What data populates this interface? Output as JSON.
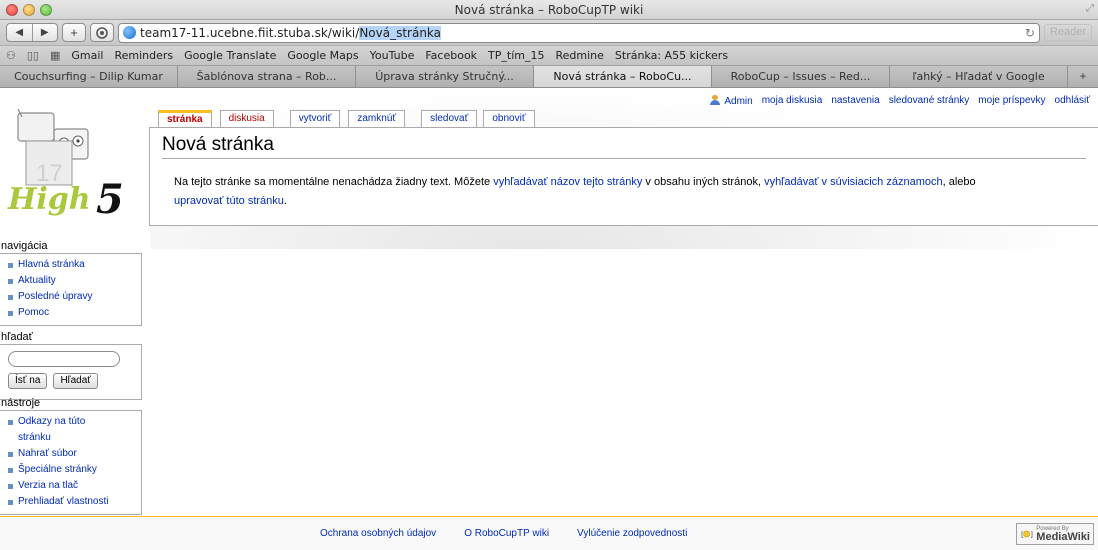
{
  "window": {
    "title": "Nová stránka – RoboCupTP wiki"
  },
  "toolbar": {
    "url_prefix": "team17-11.ucebne.fiit.stuba.sk/wiki/",
    "url_selected": "Nová_stránka",
    "reader_label": "Reader"
  },
  "bookmarks": [
    "Gmail",
    "Reminders",
    "Google Translate",
    "Google Maps",
    "YouTube",
    "Facebook",
    "TP_tím_15",
    "Redmine",
    "Stránka: A55 kickers"
  ],
  "tabs": [
    {
      "label": "Couchsurfing – Dilip Kumar",
      "active": false
    },
    {
      "label": "Šablónova strana – Rob...",
      "active": false
    },
    {
      "label": "Úprava stránky Stručný...",
      "active": false
    },
    {
      "label": "Nová stránka – RoboCu...",
      "active": true
    },
    {
      "label": "RoboCup – Issues – Red...",
      "active": false
    },
    {
      "label": "ľahký – Hľadať v Google",
      "active": false
    }
  ],
  "personal": {
    "user": "Admin",
    "links": [
      "moja diskusia",
      "nastavenia",
      "sledované stránky",
      "moje príspevky",
      "odhlásiť"
    ]
  },
  "page_tabs": {
    "article": "stránka",
    "discussion": "diskusia",
    "create": "vytvoriť",
    "protect": "zamknúť",
    "watch": "sledovať",
    "purge": "obnoviť"
  },
  "content": {
    "heading": "Nová stránka",
    "text_1": "Na tejto stránke sa momentálne nenachádza žiadny text. Môžete ",
    "link_1": "vyhľadávať názov tejto stránky",
    "text_2": " v obsahu iných stránok, ",
    "link_2": "vyhľadávať v súvisiacich záznamoch",
    "text_3": ", alebo",
    "link_3": "upravovať túto stránku",
    "text_4": "."
  },
  "logo": {
    "number": "17",
    "word": "High",
    "digit": "5"
  },
  "navigation": {
    "title": "navigácia",
    "items": [
      "Hlavná stránka",
      "Aktuality",
      "Posledné úpravy",
      "Pomoc"
    ]
  },
  "search": {
    "title": "hľadať",
    "go_label": "Ísť na",
    "search_label": "Hľadať"
  },
  "tools": {
    "title": "nástroje",
    "items": [
      "Odkazy na túto stránku",
      "Nahrať súbor",
      "Špeciálne stránky",
      "Verzia na tlač",
      "Prehliadať vlastnosti"
    ]
  },
  "footer": {
    "links": [
      "Ochrana osobných údajov",
      "O RoboCupTP wiki",
      "Vylúčenie zodpovednosti"
    ],
    "powered_small": "Powered By",
    "powered_big": "MediaWiki"
  },
  "colors": {
    "link": "#002bb8",
    "new_link": "#ba0000",
    "accent": "#fabd23"
  }
}
